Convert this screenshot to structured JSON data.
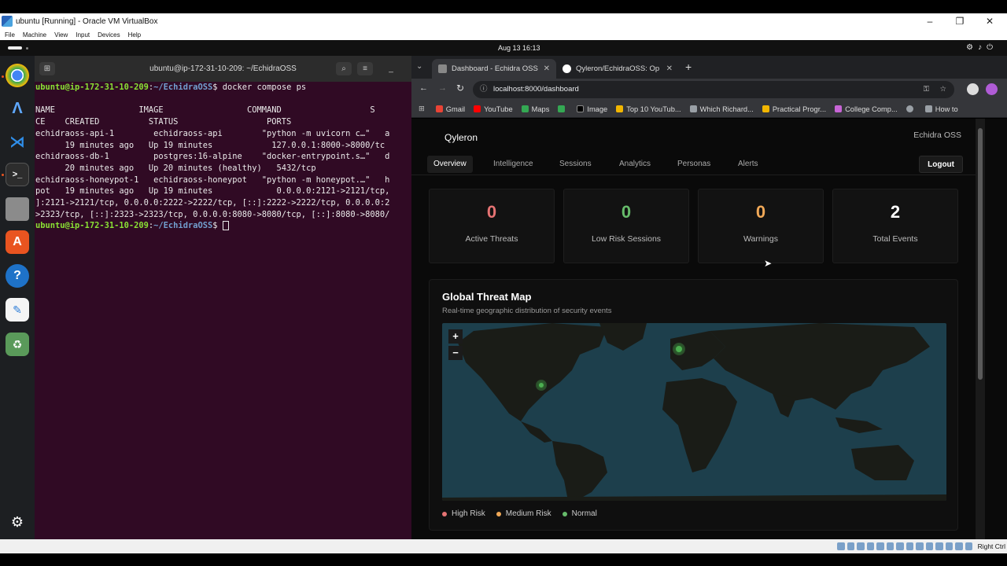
{
  "vbox": {
    "title": "ubuntu [Running] - Oracle VM VirtualBox",
    "menu": [
      "File",
      "Machine",
      "View",
      "Input",
      "Devices",
      "Help"
    ],
    "status_host_key": "Right Ctrl"
  },
  "ubuntu_panel": {
    "clock": "Aug 13  16:13"
  },
  "terminal": {
    "title": "ubuntu@ip-172-31-10-209: ~/EchidraOSS",
    "prompt_user": "ubuntu@ip-172-31-10-209",
    "prompt_path": "~/EchidraOSS",
    "command": "docker compose ps",
    "lines": [
      "NAME                 IMAGE                 COMMAND                  S",
      "CE    CREATED          STATUS                  PORTS",
      "echidraoss-api-1        echidraoss-api        \"python -m uvicorn c…\"   a",
      "      19 minutes ago   Up 19 minutes            127.0.0.1:8000->8000/tc",
      "echidraoss-db-1         postgres:16-alpine    \"docker-entrypoint.s…\"   d",
      "      20 minutes ago   Up 20 minutes (healthy)   5432/tcp",
      "echidraoss-honeypot-1   echidraoss-honeypot   \"python -m honeypot.…\"   h",
      "pot   19 minutes ago   Up 19 minutes             0.0.0.0:2121->2121/tcp,",
      "]:2121->2121/tcp, 0.0.0.0:2222->2222/tcp, [::]:2222->2222/tcp, 0.0.0.0:2",
      ">2323/tcp, [::]:2323->2323/tcp, 0.0.0.0:8080->8080/tcp, [::]:8080->8080/"
    ]
  },
  "browser": {
    "tabs": [
      {
        "label": "Dashboard - Echidra OSS",
        "active": true
      },
      {
        "label": "Qyleron/EchidraOSS: Op",
        "active": false
      }
    ],
    "new_tab": "+",
    "url": "localhost:8000/dashboard",
    "bookmarks": [
      {
        "label": "Gmail",
        "color": "#ea4335"
      },
      {
        "label": "YouTube",
        "color": "#ff0000"
      },
      {
        "label": "Maps",
        "color": "#34a853"
      },
      {
        "label": "",
        "color": "#34a853"
      },
      {
        "label": "Image",
        "color": "#000000"
      },
      {
        "label": "Top 10 YouTub...",
        "color": "#f2b600"
      },
      {
        "label": "Which Richard...",
        "color": "#9aa0a6"
      },
      {
        "label": "Practical Progr...",
        "color": "#f2b600"
      },
      {
        "label": "College Comp...",
        "color": "#c865d6"
      },
      {
        "label": "",
        "color": "#9aa0a6"
      },
      {
        "label": "How to",
        "color": "#9aa0a6"
      }
    ]
  },
  "app": {
    "brand": "Qyleron",
    "org": "Echidra OSS",
    "nav": [
      {
        "label": "Overview",
        "active": true
      },
      {
        "label": "Intelligence",
        "active": false
      },
      {
        "label": "Sessions",
        "active": false
      },
      {
        "label": "Analytics",
        "active": false
      },
      {
        "label": "Personas",
        "active": false
      },
      {
        "label": "Alerts",
        "active": false
      }
    ],
    "logout": "Logout",
    "stats": [
      {
        "value": "0",
        "label": "Active Threats",
        "color": "#e57373"
      },
      {
        "value": "0",
        "label": "Low Risk Sessions",
        "color": "#66bb6a"
      },
      {
        "value": "0",
        "label": "Warnings",
        "color": "#f0a857"
      },
      {
        "value": "2",
        "label": "Total Events",
        "color": "#ffffff"
      }
    ],
    "map": {
      "title": "Global Threat Map",
      "subtitle": "Real-time geographic distribution of security events",
      "zoom_in": "+",
      "zoom_out": "−",
      "legend": [
        {
          "label": "High Risk",
          "color": "#e57373"
        },
        {
          "label": "Medium Risk",
          "color": "#f0a857"
        },
        {
          "label": "Normal",
          "color": "#66bb6a"
        }
      ]
    }
  }
}
